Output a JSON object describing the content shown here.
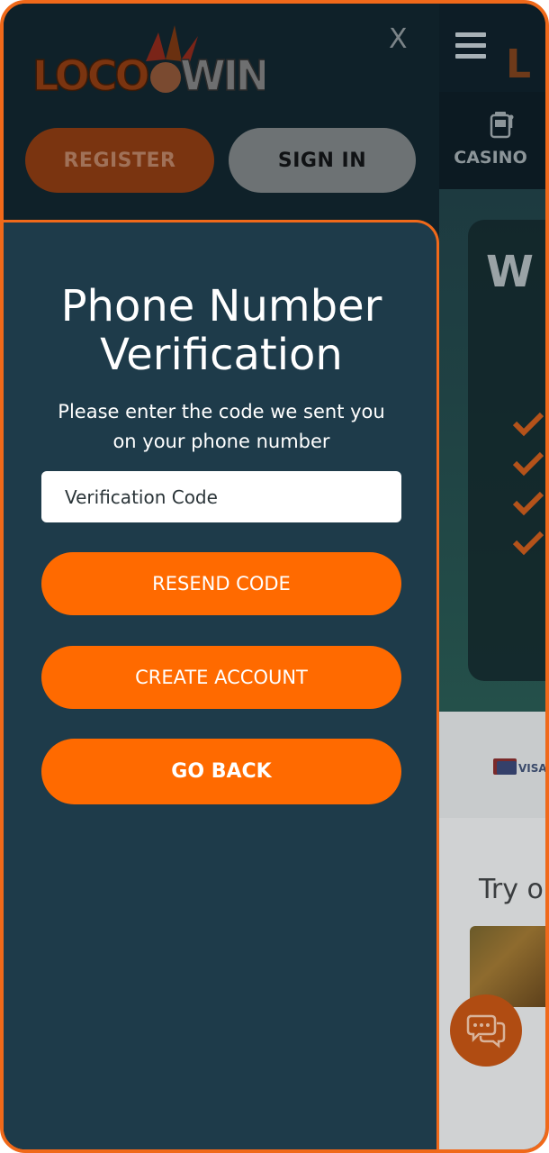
{
  "menu": {
    "logo_left": "LOCO",
    "logo_right": "WIN",
    "close_label": "X",
    "register_label": "REGISTER",
    "signin_label": "SIGN IN"
  },
  "background": {
    "nav_casino_label": "CASINO",
    "hero_heading_fragment": "W",
    "try_text_fragment": "Try ou",
    "visa_label": "VISA"
  },
  "modal": {
    "title_line1": "Phone Number",
    "title_line2": "Verification",
    "description_line1": "Please enter the code we sent you",
    "description_line2": "on your phone number",
    "code_placeholder": "Verification Code",
    "resend_label": "RESEND CODE",
    "create_label": "CREATE ACCOUNT",
    "goback_label": "GO BACK"
  },
  "colors": {
    "accent_orange": "#ff6a00",
    "frame_border": "#f0691a",
    "modal_bg": "#1e3b4a",
    "menu_bg": "#0f2129"
  },
  "icons": {
    "menu": "hamburger-icon",
    "casino": "slot-machine-icon",
    "check": "checkmark-icon",
    "chat": "chat-bubbles-icon",
    "payment": "visa-card-icon"
  }
}
